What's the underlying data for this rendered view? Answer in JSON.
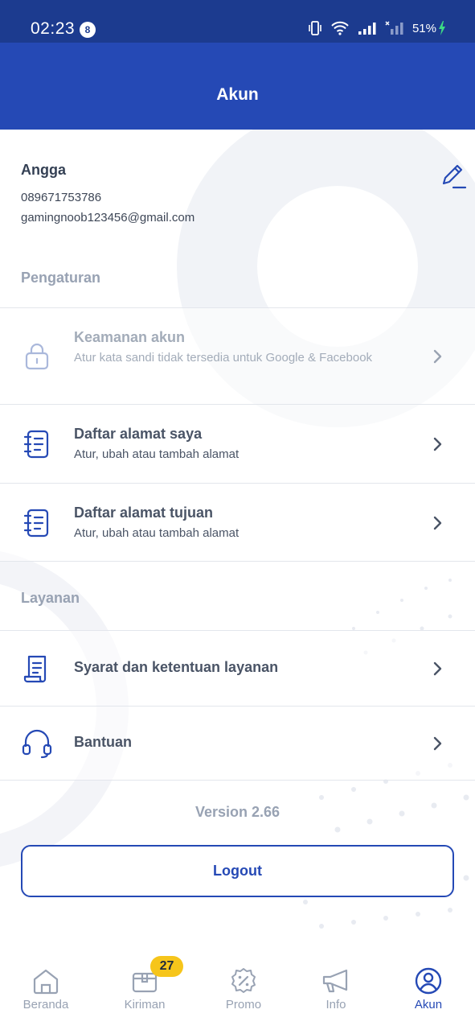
{
  "status_bar": {
    "time": "02:23",
    "notification_count": "8",
    "battery": "51%"
  },
  "header": {
    "title": "Akun"
  },
  "profile": {
    "name": "Angga",
    "phone": "089671753786",
    "email": "gamingnoob123456@gmail.com"
  },
  "settings": {
    "title": "Pengaturan",
    "items": [
      {
        "title": "Keamanan akun",
        "subtitle": "Atur kata sandi tidak tersedia untuk Google & Facebook",
        "icon": "lock-icon",
        "disabled": true
      },
      {
        "title": "Daftar alamat saya",
        "subtitle": "Atur, ubah atau tambah alamat",
        "icon": "address-book-icon"
      },
      {
        "title": "Daftar alamat tujuan",
        "subtitle": "Atur, ubah atau tambah alamat",
        "icon": "address-book-icon"
      }
    ]
  },
  "services": {
    "title": "Layanan",
    "items": [
      {
        "title": "Syarat dan ketentuan layanan",
        "icon": "document-icon"
      },
      {
        "title": "Bantuan",
        "icon": "headset-icon"
      }
    ]
  },
  "version": "Version 2.66",
  "logout_label": "Logout",
  "bottom_nav": {
    "items": [
      {
        "label": "Beranda",
        "icon": "home-icon"
      },
      {
        "label": "Kiriman",
        "icon": "package-icon",
        "badge": "27"
      },
      {
        "label": "Promo",
        "icon": "promo-icon"
      },
      {
        "label": "Info",
        "icon": "megaphone-icon"
      },
      {
        "label": "Akun",
        "icon": "account-icon",
        "active": true
      }
    ]
  },
  "colors": {
    "primary": "#2549b5",
    "status_bar": "#1c3b8f",
    "badge": "#f6c51b",
    "muted": "#98a2b3"
  }
}
